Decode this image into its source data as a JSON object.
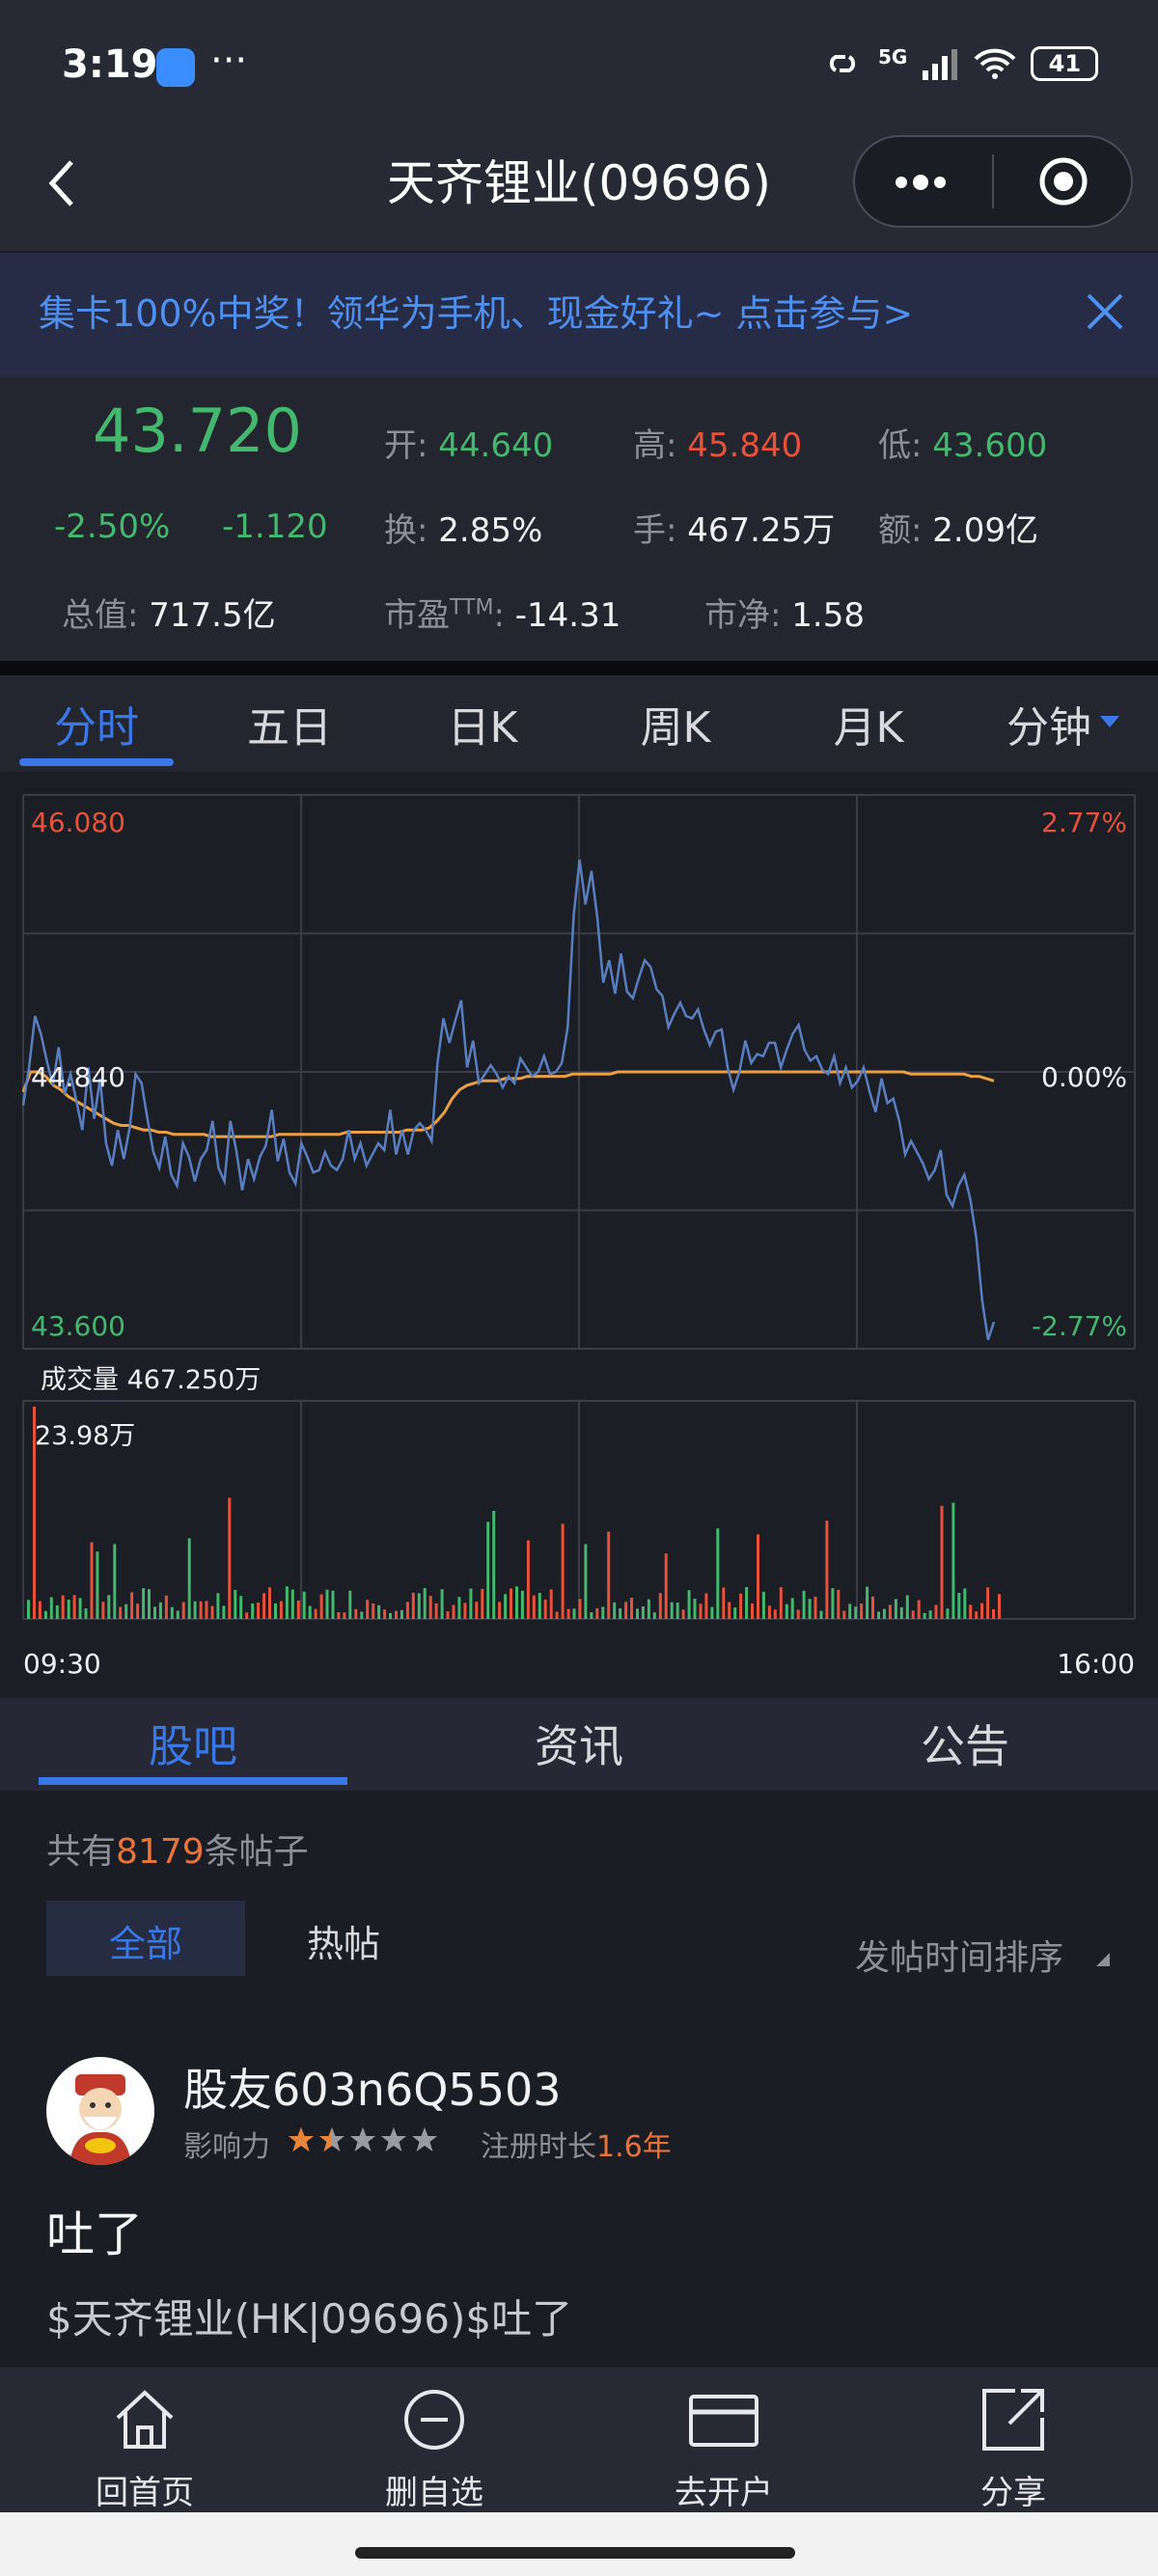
{
  "status_bar": {
    "time": "3:19",
    "more": "···",
    "network": "5G",
    "battery": "41"
  },
  "title_bar": {
    "title": "天齐锂业(09696)"
  },
  "banner": {
    "text": "集卡100%中奖！领华为手机、现金好礼~ 点击参与>"
  },
  "quote": {
    "price": "43.720",
    "change_pct": "-2.50%",
    "change": "-1.120",
    "open_label": "开:",
    "open": "44.640",
    "high_label": "高:",
    "high": "45.840",
    "low_label": "低:",
    "low": "43.600",
    "turnover_label": "换:",
    "turnover": "2.85%",
    "volume_label": "手:",
    "volume": "467.25万",
    "amount_label": "额:",
    "amount": "2.09亿",
    "mcap_label": "总值:",
    "mcap": "717.5亿",
    "pe_label": "市盈",
    "pe_sup": "TTM",
    "pe_colon": ":",
    "pe": "-14.31",
    "pb_label": "市净:",
    "pb": "1.58"
  },
  "chart_tabs": [
    "分时",
    "五日",
    "日K",
    "周K",
    "月K",
    "分钟"
  ],
  "chart_data": {
    "type": "line",
    "y_top": "46.080",
    "y_mid": "44.840",
    "y_bottom": "43.600",
    "pct_top": "2.77%",
    "pct_mid": "0.00%",
    "pct_bottom": "-2.77%",
    "ylim": [
      43.6,
      46.08
    ],
    "prev_close": 44.84,
    "volume_title": "成交量 467.250万",
    "volume_max_label": "23.98万",
    "x_start": "09:30",
    "x_end": "16:00",
    "series": [
      {
        "name": "price",
        "values": [
          44.69,
          44.86,
          45.09,
          45.01,
          44.89,
          44.78,
          44.95,
          44.74,
          44.83,
          44.71,
          44.58,
          44.86,
          44.63,
          44.81,
          44.52,
          44.42,
          44.58,
          44.45,
          44.59,
          44.83,
          44.79,
          44.63,
          44.48,
          44.41,
          44.55,
          44.38,
          44.33,
          44.52,
          44.46,
          44.35,
          44.45,
          44.49,
          44.62,
          44.41,
          44.35,
          44.62,
          44.49,
          44.31,
          44.45,
          44.36,
          44.46,
          44.51,
          44.67,
          44.44,
          44.54,
          44.39,
          44.34,
          44.52,
          44.46,
          44.39,
          44.4,
          44.48,
          44.42,
          44.4,
          44.45,
          44.58,
          44.45,
          44.52,
          44.42,
          44.47,
          44.52,
          44.49,
          44.67,
          44.47,
          44.58,
          44.47,
          44.58,
          44.61,
          44.58,
          44.53,
          44.88,
          45.08,
          44.97,
          45.07,
          45.16,
          44.86,
          44.98,
          44.79,
          44.83,
          44.87,
          44.83,
          44.77,
          44.82,
          44.79,
          44.9,
          44.86,
          44.82,
          44.84,
          44.91,
          44.83,
          44.84,
          44.88,
          45.04,
          45.54,
          45.79,
          45.59,
          45.74,
          45.53,
          45.24,
          45.34,
          45.19,
          45.37,
          45.2,
          45.17,
          45.26,
          45.34,
          45.31,
          45.21,
          45.18,
          45.04,
          45.1,
          45.15,
          45.09,
          45.08,
          45.12,
          45.03,
          44.96,
          45.02,
          45.03,
          44.86,
          44.76,
          44.84,
          44.98,
          44.88,
          44.92,
          44.91,
          44.97,
          44.97,
          44.86,
          44.94,
          45.01,
          45.05,
          44.94,
          44.89,
          44.91,
          44.85,
          44.83,
          44.91,
          44.79,
          44.86,
          44.77,
          44.8,
          44.86,
          44.75,
          44.66,
          44.81,
          44.7,
          44.72,
          44.62,
          44.47,
          44.53,
          44.48,
          44.43,
          44.36,
          44.4,
          44.49,
          44.29,
          44.24,
          44.33,
          44.38,
          44.27,
          44.1,
          43.82,
          43.64,
          43.72
        ]
      },
      {
        "name": "avg",
        "values": [
          44.75,
          44.84,
          44.84,
          44.82,
          44.78,
          44.76,
          44.73,
          44.71,
          44.69,
          44.67,
          44.65,
          44.63,
          44.61,
          44.6,
          44.6,
          44.59,
          44.58,
          44.58,
          44.57,
          44.57,
          44.56,
          44.56,
          44.56,
          44.56,
          44.56,
          44.55,
          44.55,
          44.55,
          44.55,
          44.55,
          44.55,
          44.55,
          44.55,
          44.55,
          44.56,
          44.56,
          44.56,
          44.56,
          44.56,
          44.56,
          44.56,
          44.56,
          44.56,
          44.57,
          44.57,
          44.57,
          44.57,
          44.57,
          44.57,
          44.57,
          44.57,
          44.58,
          44.58,
          44.58,
          44.59,
          44.62,
          44.66,
          44.72,
          44.76,
          44.78,
          44.79,
          44.8,
          44.8,
          44.8,
          44.81,
          44.81,
          44.81,
          44.82,
          44.82,
          44.82,
          44.82,
          44.82,
          44.82,
          44.83,
          44.83,
          44.83,
          44.83,
          44.83,
          44.83,
          44.84,
          44.84,
          44.84,
          44.84,
          44.84,
          44.84,
          44.84,
          44.84,
          44.84,
          44.84,
          44.84,
          44.84,
          44.84,
          44.84,
          44.84,
          44.84,
          44.84,
          44.84,
          44.84,
          44.84,
          44.84,
          44.84,
          44.84,
          44.84,
          44.84,
          44.84,
          44.84,
          44.84,
          44.84,
          44.84,
          44.84,
          44.84,
          44.84,
          44.84,
          44.84,
          44.84,
          44.84,
          44.84,
          44.84,
          44.83,
          44.83,
          44.83,
          44.83,
          44.83,
          44.83,
          44.83,
          44.83,
          44.82,
          44.82,
          44.81,
          44.8
        ]
      }
    ]
  },
  "forum": {
    "tabs": [
      "股吧",
      "资讯",
      "公告"
    ],
    "count_prefix": "共有",
    "count": "8179",
    "count_suffix": "条帖子",
    "filter_all": "全部",
    "filter_hot": "热帖",
    "sort": "发帖时间排序",
    "post": {
      "user": "股友603n6Q5503",
      "influence_label": "影响力",
      "stars": 1.5,
      "reg_label": "注册时长",
      "reg_value": "1.6年",
      "title": "吐了",
      "body": "$天齐锂业(HK|09696)$吐了"
    }
  },
  "bottom_nav": [
    {
      "label": "回首页",
      "icon": "home-icon"
    },
    {
      "label": "删自选",
      "icon": "remove-watchlist-icon"
    },
    {
      "label": "去开户",
      "icon": "card-icon"
    },
    {
      "label": "分享",
      "icon": "share-icon"
    }
  ],
  "colors": {
    "up": "#e8523a",
    "down": "#43b86e",
    "price_line": "#5a7fc0",
    "avg_line": "#e9a044",
    "accent": "#3b78e7"
  }
}
